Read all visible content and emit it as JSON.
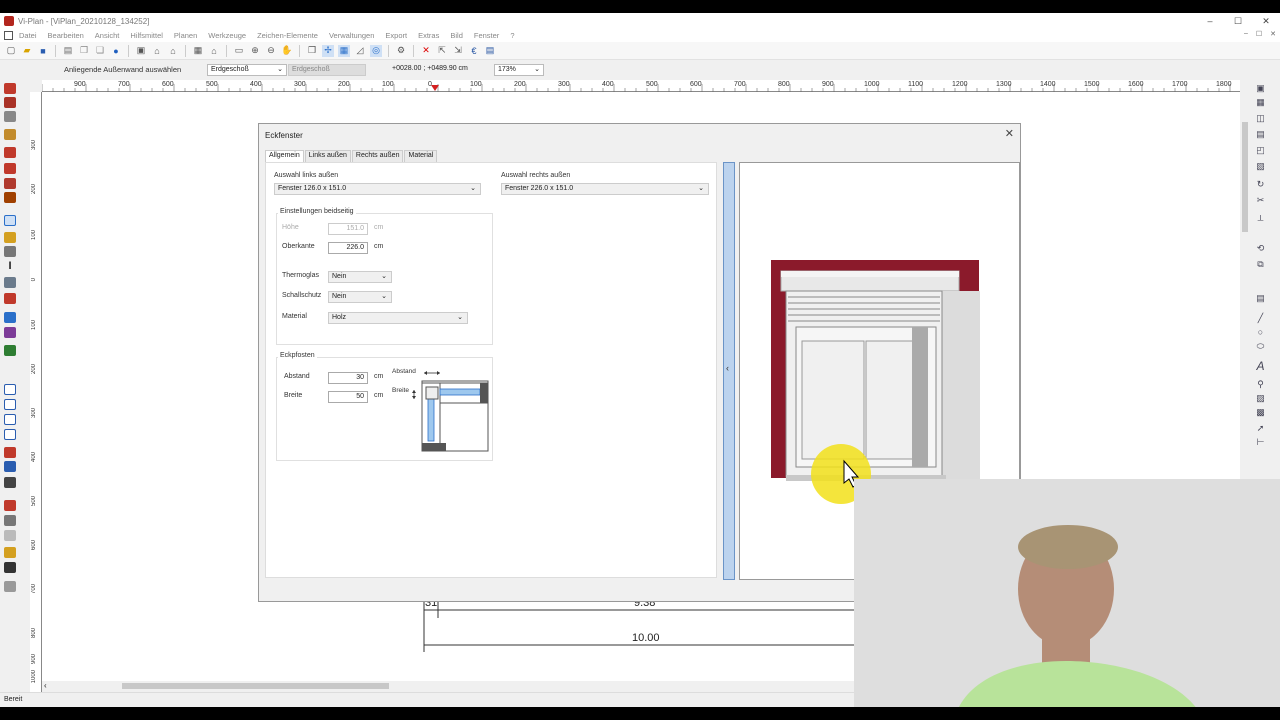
{
  "window": {
    "title": "Vi-Plan - [ViPlan_20210128_134252]",
    "controls": [
      "–",
      "☐",
      "✕"
    ],
    "mdi_controls": [
      "–",
      "☐",
      "✕"
    ]
  },
  "menu": [
    "Datei",
    "Bearbeiten",
    "Ansicht",
    "Hilfsmittel",
    "Planen",
    "Werkzeuge",
    "Zeichen-Elemente",
    "Verwaltungen",
    "Export",
    "Extras",
    "Bild",
    "Fenster",
    "?"
  ],
  "context": {
    "hint": "Anliegende Außenwand auswählen",
    "floor": "Erdgeschoß",
    "floor_ref": "Erdgeschoß",
    "coords": "+0028.00 ; +0489.90 cm",
    "zoom": "173%"
  },
  "ruler": {
    "top_labels": [
      "900",
      "700",
      "600",
      "500",
      "400",
      "300",
      "200",
      "100",
      "0",
      "100",
      "200",
      "300",
      "400",
      "500",
      "600",
      "700",
      "800",
      "900",
      "1000",
      "1100",
      "1200",
      "1300",
      "1400",
      "1500",
      "1600",
      "1700",
      "1800"
    ],
    "left_labels": [
      "300",
      "200",
      "100",
      "0",
      "100",
      "200",
      "300",
      "400",
      "500",
      "600",
      "700",
      "800",
      "900",
      "1000"
    ]
  },
  "dimensions": {
    "small": "31",
    "inner": "9.38",
    "total": "10.00"
  },
  "status": "Bereit",
  "dialog": {
    "title": "Eckfenster",
    "close": "✕",
    "tabs": [
      "Allgemein",
      "Links außen",
      "Rechts außen",
      "Material"
    ],
    "left_choice_label": "Auswahl links außen",
    "left_choice": "Fenster 126.0 x 151.0",
    "right_choice_label": "Auswahl rechts außen",
    "right_choice": "Fenster 226.0 x 151.0",
    "both_group": "Einstellungen beidseitig",
    "height_label": "Höhe",
    "height_value": "151.0",
    "height_unit": "cm",
    "top_label": "Oberkante",
    "top_value": "226.0",
    "top_unit": "cm",
    "thermo_label": "Thermoglas",
    "thermo_value": "Nein",
    "sound_label": "Schallschutz",
    "sound_value": "Nein",
    "material_label": "Material",
    "material_value": "Holz",
    "post_group": "Eckpfosten",
    "distance_label": "Abstand",
    "distance_value": "30",
    "distance_unit": "cm",
    "width_label": "Breite",
    "width_value": "50",
    "width_unit": "cm",
    "diagram_distance": "Abstand",
    "diagram_width": "Breite",
    "splitter_arrow": "‹"
  },
  "colors": {
    "wall_red": "#8b1a2b",
    "splitter": "#bcd3ee",
    "cursor_highlight": "#f2e01a"
  }
}
